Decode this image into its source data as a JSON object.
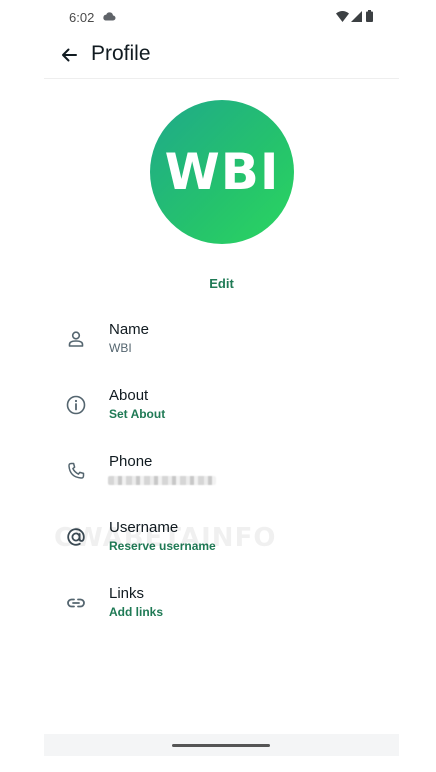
{
  "status_bar": {
    "time": "6:02",
    "icons": [
      "cloud-icon",
      "wifi-icon",
      "signal-icon",
      "battery-icon"
    ]
  },
  "header": {
    "title": "Profile",
    "back_icon": "arrow-left-icon"
  },
  "avatar": {
    "text": "WBI",
    "gradient_colors": [
      "#1fa98a",
      "#2bd660"
    ]
  },
  "edit_label": "Edit",
  "rows": [
    {
      "icon": "person-icon",
      "label": "Name",
      "value": "WBI",
      "value_style": "secondary"
    },
    {
      "icon": "info-icon",
      "label": "About",
      "value": "Set About",
      "value_style": "accent"
    },
    {
      "icon": "phone-icon",
      "label": "Phone",
      "value": "",
      "value_style": "blurred"
    },
    {
      "icon": "at-icon",
      "label": "Username",
      "value": "Reserve username",
      "value_style": "accent"
    },
    {
      "icon": "link-icon",
      "label": "Links",
      "value": "Add links",
      "value_style": "accent"
    }
  ],
  "watermark": "CWABETAINFO",
  "colors": {
    "accent": "#1f7a55",
    "secondary_text": "#54656f",
    "primary_text": "#111b21"
  }
}
